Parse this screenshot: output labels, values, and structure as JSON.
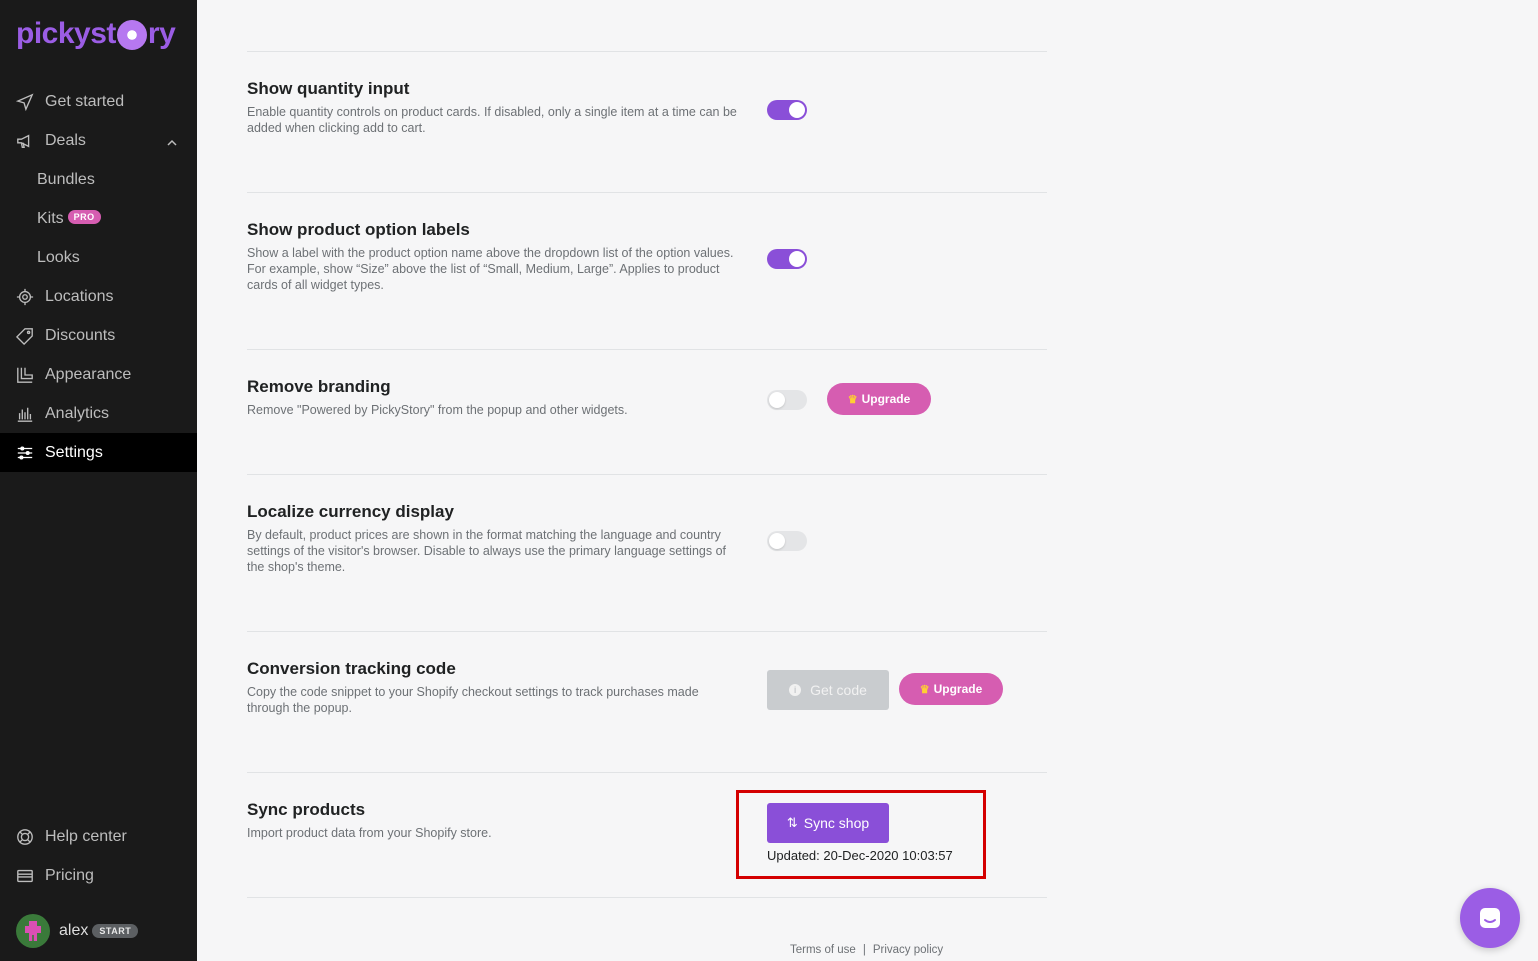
{
  "brand": {
    "logo_text_left": "pickyst",
    "logo_text_right": "ry"
  },
  "sidebar": {
    "items": [
      {
        "label": "Get started",
        "icon": "send-icon"
      },
      {
        "label": "Deals",
        "icon": "megaphone-icon"
      },
      {
        "label": "Bundles"
      },
      {
        "label": "Kits",
        "badge": "PRO"
      },
      {
        "label": "Looks"
      },
      {
        "label": "Locations",
        "icon": "target-icon"
      },
      {
        "label": "Discounts",
        "icon": "tag-icon"
      },
      {
        "label": "Appearance",
        "icon": "layout-icon"
      },
      {
        "label": "Analytics",
        "icon": "bar-chart-icon"
      },
      {
        "label": "Settings",
        "icon": "sliders-icon",
        "active": true
      }
    ],
    "bottom": [
      {
        "label": "Help center",
        "icon": "lifebuoy-icon"
      },
      {
        "label": "Pricing",
        "icon": "credit-card-icon"
      }
    ],
    "user": {
      "name": "alex",
      "plan": "START"
    }
  },
  "settings": {
    "quantity": {
      "title": "Show quantity input",
      "desc": "Enable quantity controls on product cards. If disabled, only a single item at a time can be added when clicking add to cart.",
      "enabled": true
    },
    "option_labels": {
      "title": "Show product option labels",
      "desc": "Show a label with the product option name above the dropdown list of the option values. For example, show “Size” above the list of “Small, Medium, Large”. Applies to product cards of all widget types.",
      "enabled": true
    },
    "branding": {
      "title": "Remove branding",
      "desc": "Remove \"Powered by PickyStory\" from the popup and other widgets.",
      "enabled": false,
      "upgrade_label": "Upgrade"
    },
    "currency": {
      "title": "Localize currency display",
      "desc": "By default, product prices are shown in the format matching the language and country settings of the visitor's browser. Disable to always use the primary language settings of the shop's theme.",
      "enabled": false
    },
    "tracking": {
      "title": "Conversion tracking code",
      "desc": "Copy the code snippet to your Shopify checkout settings to track purchases made through the popup.",
      "get_code_label": "Get code",
      "upgrade_label": "Upgrade"
    },
    "sync": {
      "title": "Sync products",
      "desc": "Import product data from your Shopify store.",
      "button_label": "Sync shop",
      "updated": "Updated: 20-Dec-2020 10:03:57"
    }
  },
  "footer": {
    "terms": "Terms of use",
    "separator": "|",
    "privacy": "Privacy policy"
  },
  "colors": {
    "accent": "#8a4fd8",
    "upgrade": "#d65db1",
    "sidebar_bg": "#1a1a1a",
    "highlight": "#d40000"
  }
}
